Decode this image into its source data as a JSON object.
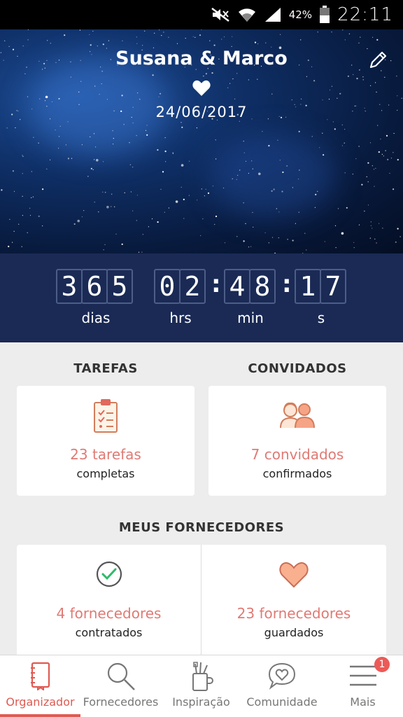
{
  "status_bar": {
    "battery": "42%",
    "time": "22:11"
  },
  "hero": {
    "couple": "Susana & Marco",
    "date": "24/06/2017"
  },
  "countdown": {
    "days": [
      "3",
      "6",
      "5"
    ],
    "hours": [
      "0",
      "2"
    ],
    "minutes": [
      "4",
      "8"
    ],
    "seconds": [
      "1",
      "7"
    ],
    "labels": {
      "days": "dias",
      "hours": "hrs",
      "minutes": "min",
      "seconds": "s"
    }
  },
  "tasks": {
    "title": "TAREFAS",
    "count": "23 tarefas",
    "sub": "completas"
  },
  "guests": {
    "title": "CONVIDADOS",
    "count": "7 convidados",
    "sub": "confirmados"
  },
  "suppliers": {
    "title": "MEUS FORNECEDORES",
    "hired": {
      "count": "4 fornecedores",
      "sub": "contratados"
    },
    "saved": {
      "count": "23 fornecedores",
      "sub": "guardados"
    }
  },
  "nav": {
    "items": [
      {
        "label": "Organizador",
        "icon": "notebook-icon"
      },
      {
        "label": "Fornecedores",
        "icon": "search-icon"
      },
      {
        "label": "Inspiração",
        "icon": "crafts-icon"
      },
      {
        "label": "Comunidade",
        "icon": "chat-heart-icon"
      },
      {
        "label": "Mais",
        "icon": "menu-icon"
      }
    ],
    "badge": "1"
  },
  "colors": {
    "accent": "#e05a52",
    "countdown_bg": "#1a2a55",
    "card_text": "#e07a74"
  }
}
